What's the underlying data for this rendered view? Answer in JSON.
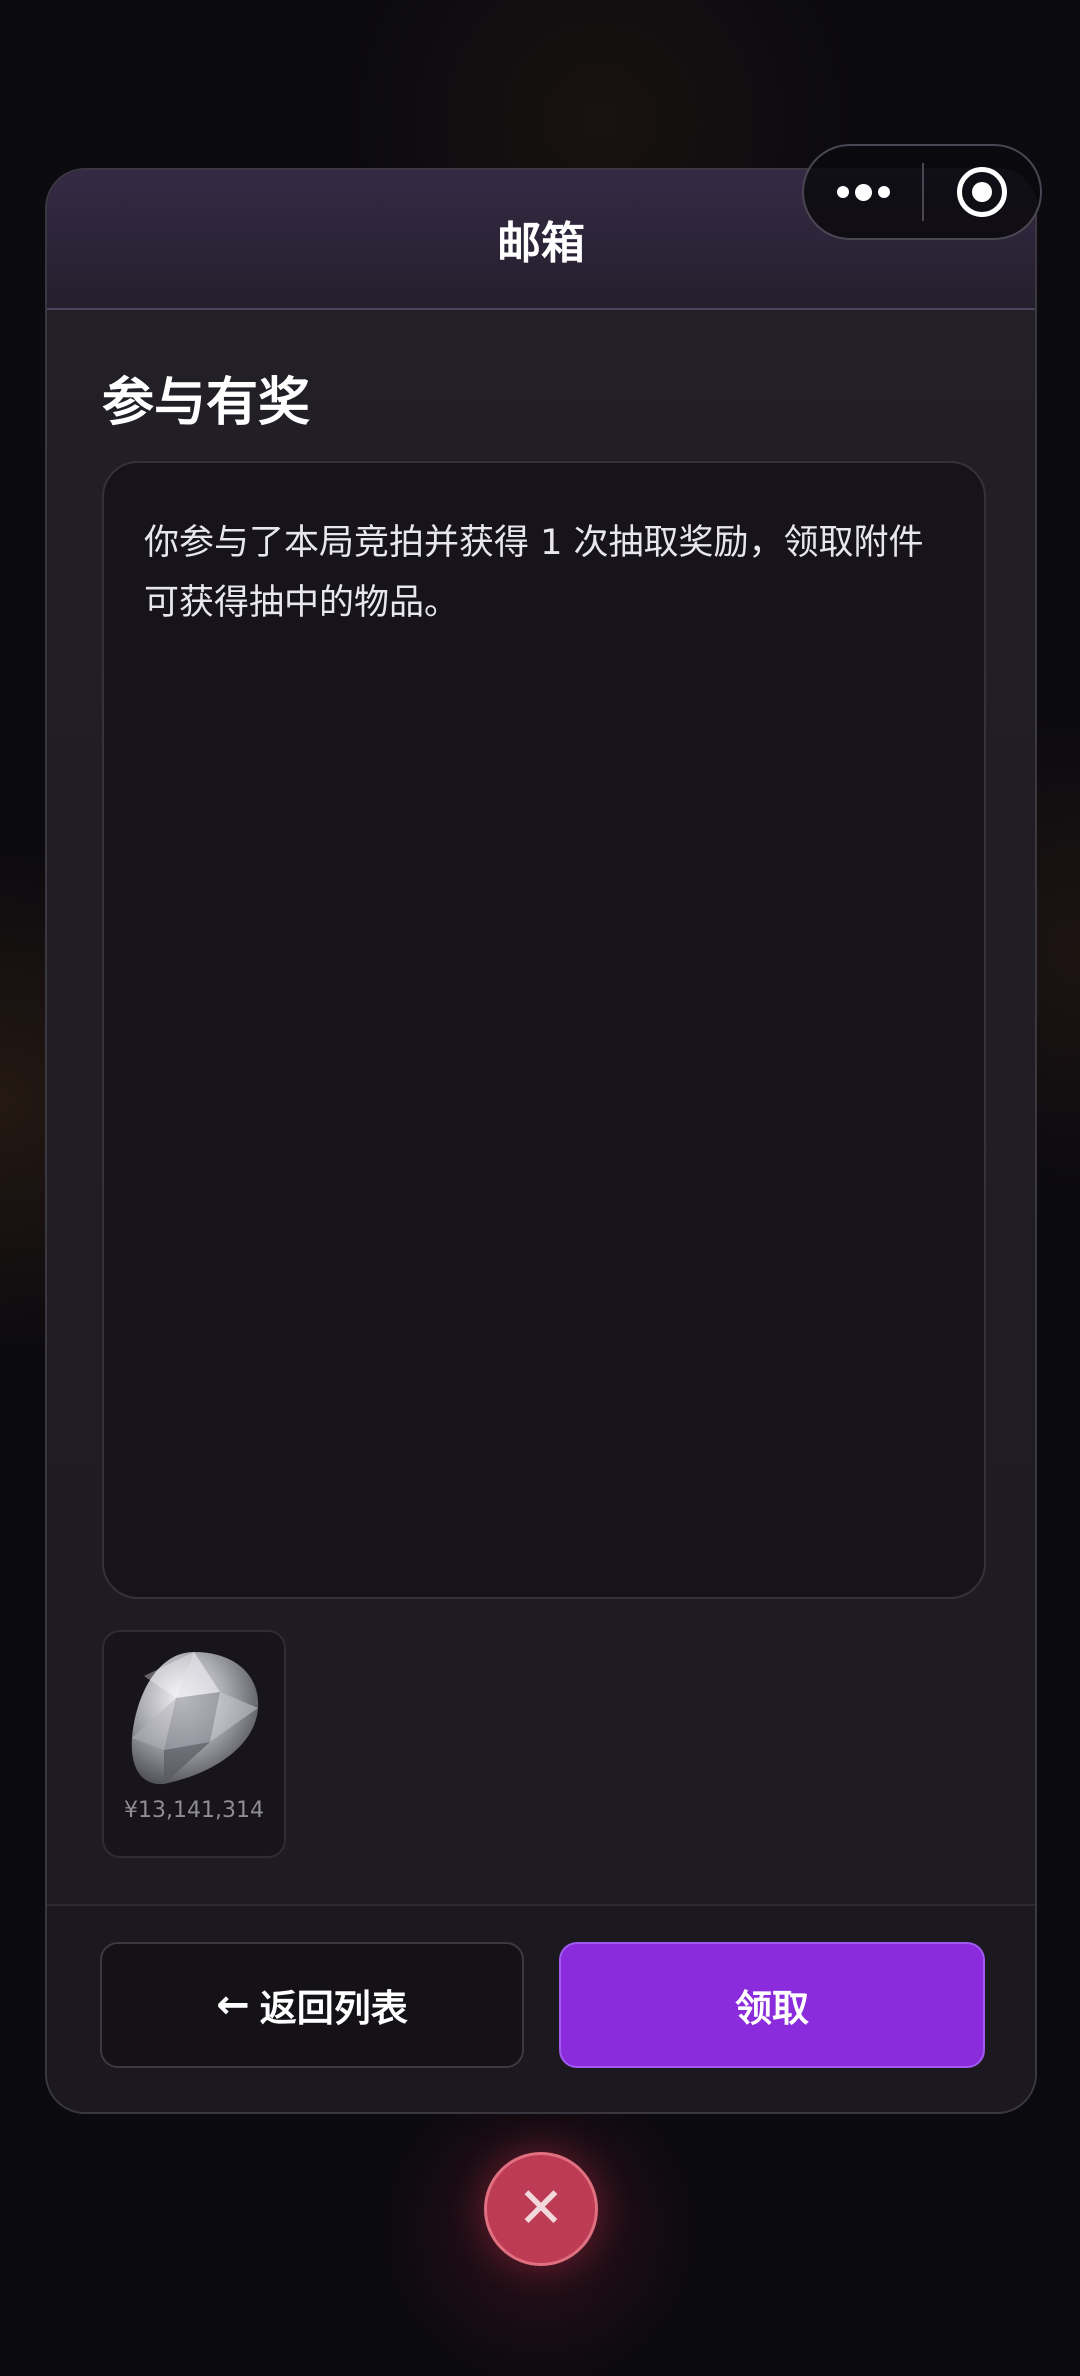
{
  "header": {
    "title": "邮箱"
  },
  "mail": {
    "subject": "参与有奖",
    "body": "你参与了本局竞拍并获得 1 次抽取奖励，领取附件可获得抽中的物品。",
    "attachment": {
      "icon": "diamond-icon",
      "value": "¥13,141,314"
    }
  },
  "footer": {
    "back_arrow": "←",
    "back_label": "返回列表",
    "claim_label": "领取"
  },
  "close": {
    "symbol": "✕"
  },
  "colors": {
    "accent": "#8a2bdc",
    "close": "#bd3b55",
    "header_top": "#352a45"
  }
}
